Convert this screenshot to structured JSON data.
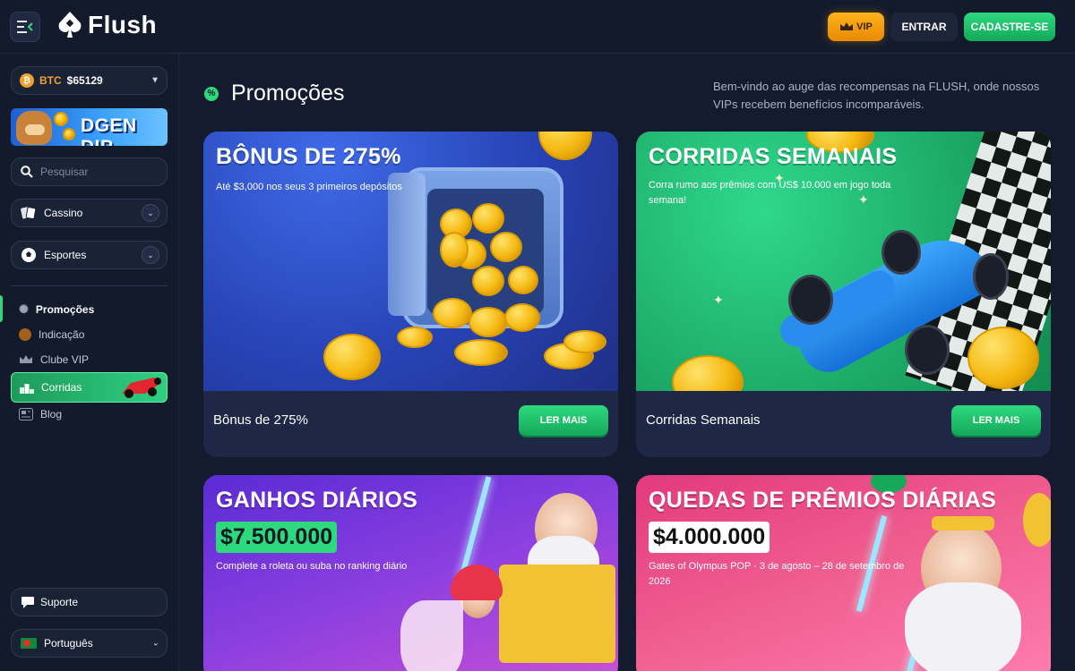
{
  "header": {
    "brand": "Flush",
    "vip_label": "VIP",
    "login_label": "ENTRAR",
    "signup_label": "CADASTRE-SE"
  },
  "sidebar": {
    "btc": {
      "symbol": "BTC",
      "value": "$65129"
    },
    "banner_text": "DGEN DIP",
    "search_placeholder": "Pesquisar",
    "casino_label": "Cassino",
    "sports_label": "Esportes",
    "nav": [
      {
        "label": "Promoções",
        "icon": "megaphone-icon",
        "active": true
      },
      {
        "label": "Indicação",
        "icon": "coin-icon"
      },
      {
        "label": "Clube VIP",
        "icon": "crown-icon"
      },
      {
        "label": "Corridas",
        "icon": "podium-icon",
        "highlight": true
      },
      {
        "label": "Blog",
        "icon": "newspaper-icon"
      }
    ],
    "support_label": "Suporte",
    "language_label": "Português"
  },
  "main": {
    "title": "Promoções",
    "welcome": "Bem-vindo ao auge das recompensas na FLUSH, onde nossos VIPs recebem benefícios incomparáveis.",
    "cards": [
      {
        "heading": "BÔNUS DE 275%",
        "subtitle": "Até $3,000 nos seus 3 primeiros depósitos",
        "footer_title": "Bônus de 275%",
        "button": "LER MAIS"
      },
      {
        "heading": "CORRIDAS SEMANAIS",
        "subtitle": "Corra rumo aos prêmios com US$ 10.000 em jogo toda semana!",
        "footer_title": "Corridas Semanais",
        "button": "LER MAIS"
      },
      {
        "heading": "GANHOS DIÁRIOS",
        "amount": "$7.500.000",
        "subtitle": "Complete a roleta ou suba no ranking diário"
      },
      {
        "heading": "QUEDAS DE PRÊMIOS DIÁRIAS",
        "amount": "$4.000.000",
        "subtitle": "Gates of Olympus POP · 3 de agosto – 28 de setembro de 2026"
      }
    ]
  },
  "colors": {
    "accent_green": "#2ed97e",
    "vip_gold": "#ffb21d",
    "background": "#141b2e"
  }
}
